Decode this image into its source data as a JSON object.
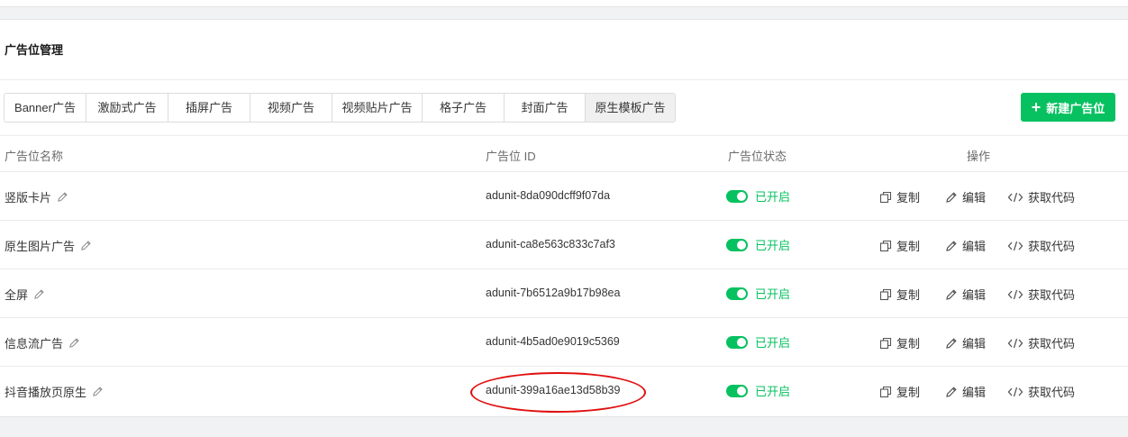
{
  "page": {
    "title": "广告位管理"
  },
  "tabs": [
    {
      "label": "Banner广告",
      "active": false
    },
    {
      "label": "激励式广告",
      "active": false
    },
    {
      "label": "插屏广告",
      "active": false
    },
    {
      "label": "视频广告",
      "active": false
    },
    {
      "label": "视频贴片广告",
      "active": false
    },
    {
      "label": "格子广告",
      "active": false
    },
    {
      "label": "封面广告",
      "active": false
    },
    {
      "label": "原生模板广告",
      "active": true
    }
  ],
  "new_button": {
    "label": "新建广告位",
    "icon": "plus-icon"
  },
  "table": {
    "headers": {
      "name": "广告位名称",
      "id": "广告位 ID",
      "status": "广告位状态",
      "actions": "操作"
    },
    "rows": [
      {
        "name": "竖版卡片",
        "id": "adunit-8da090dcff9f07da",
        "status": "已开启"
      },
      {
        "name": "原生图片广告",
        "id": "adunit-ca8e563c833c7af3",
        "status": "已开启"
      },
      {
        "name": "全屏",
        "id": "adunit-7b6512a9b17b98ea",
        "status": "已开启"
      },
      {
        "name": "信息流广告",
        "id": "adunit-4b5ad0e9019c5369",
        "status": "已开启"
      },
      {
        "name": "抖音播放页原生",
        "id": "adunit-399a16ae13d58b39",
        "status": "已开启"
      }
    ],
    "action_labels": {
      "copy": "复制",
      "edit": "编辑",
      "code": "获取代码"
    }
  },
  "colors": {
    "accent": "#07c160",
    "annotation": "#e01010"
  }
}
